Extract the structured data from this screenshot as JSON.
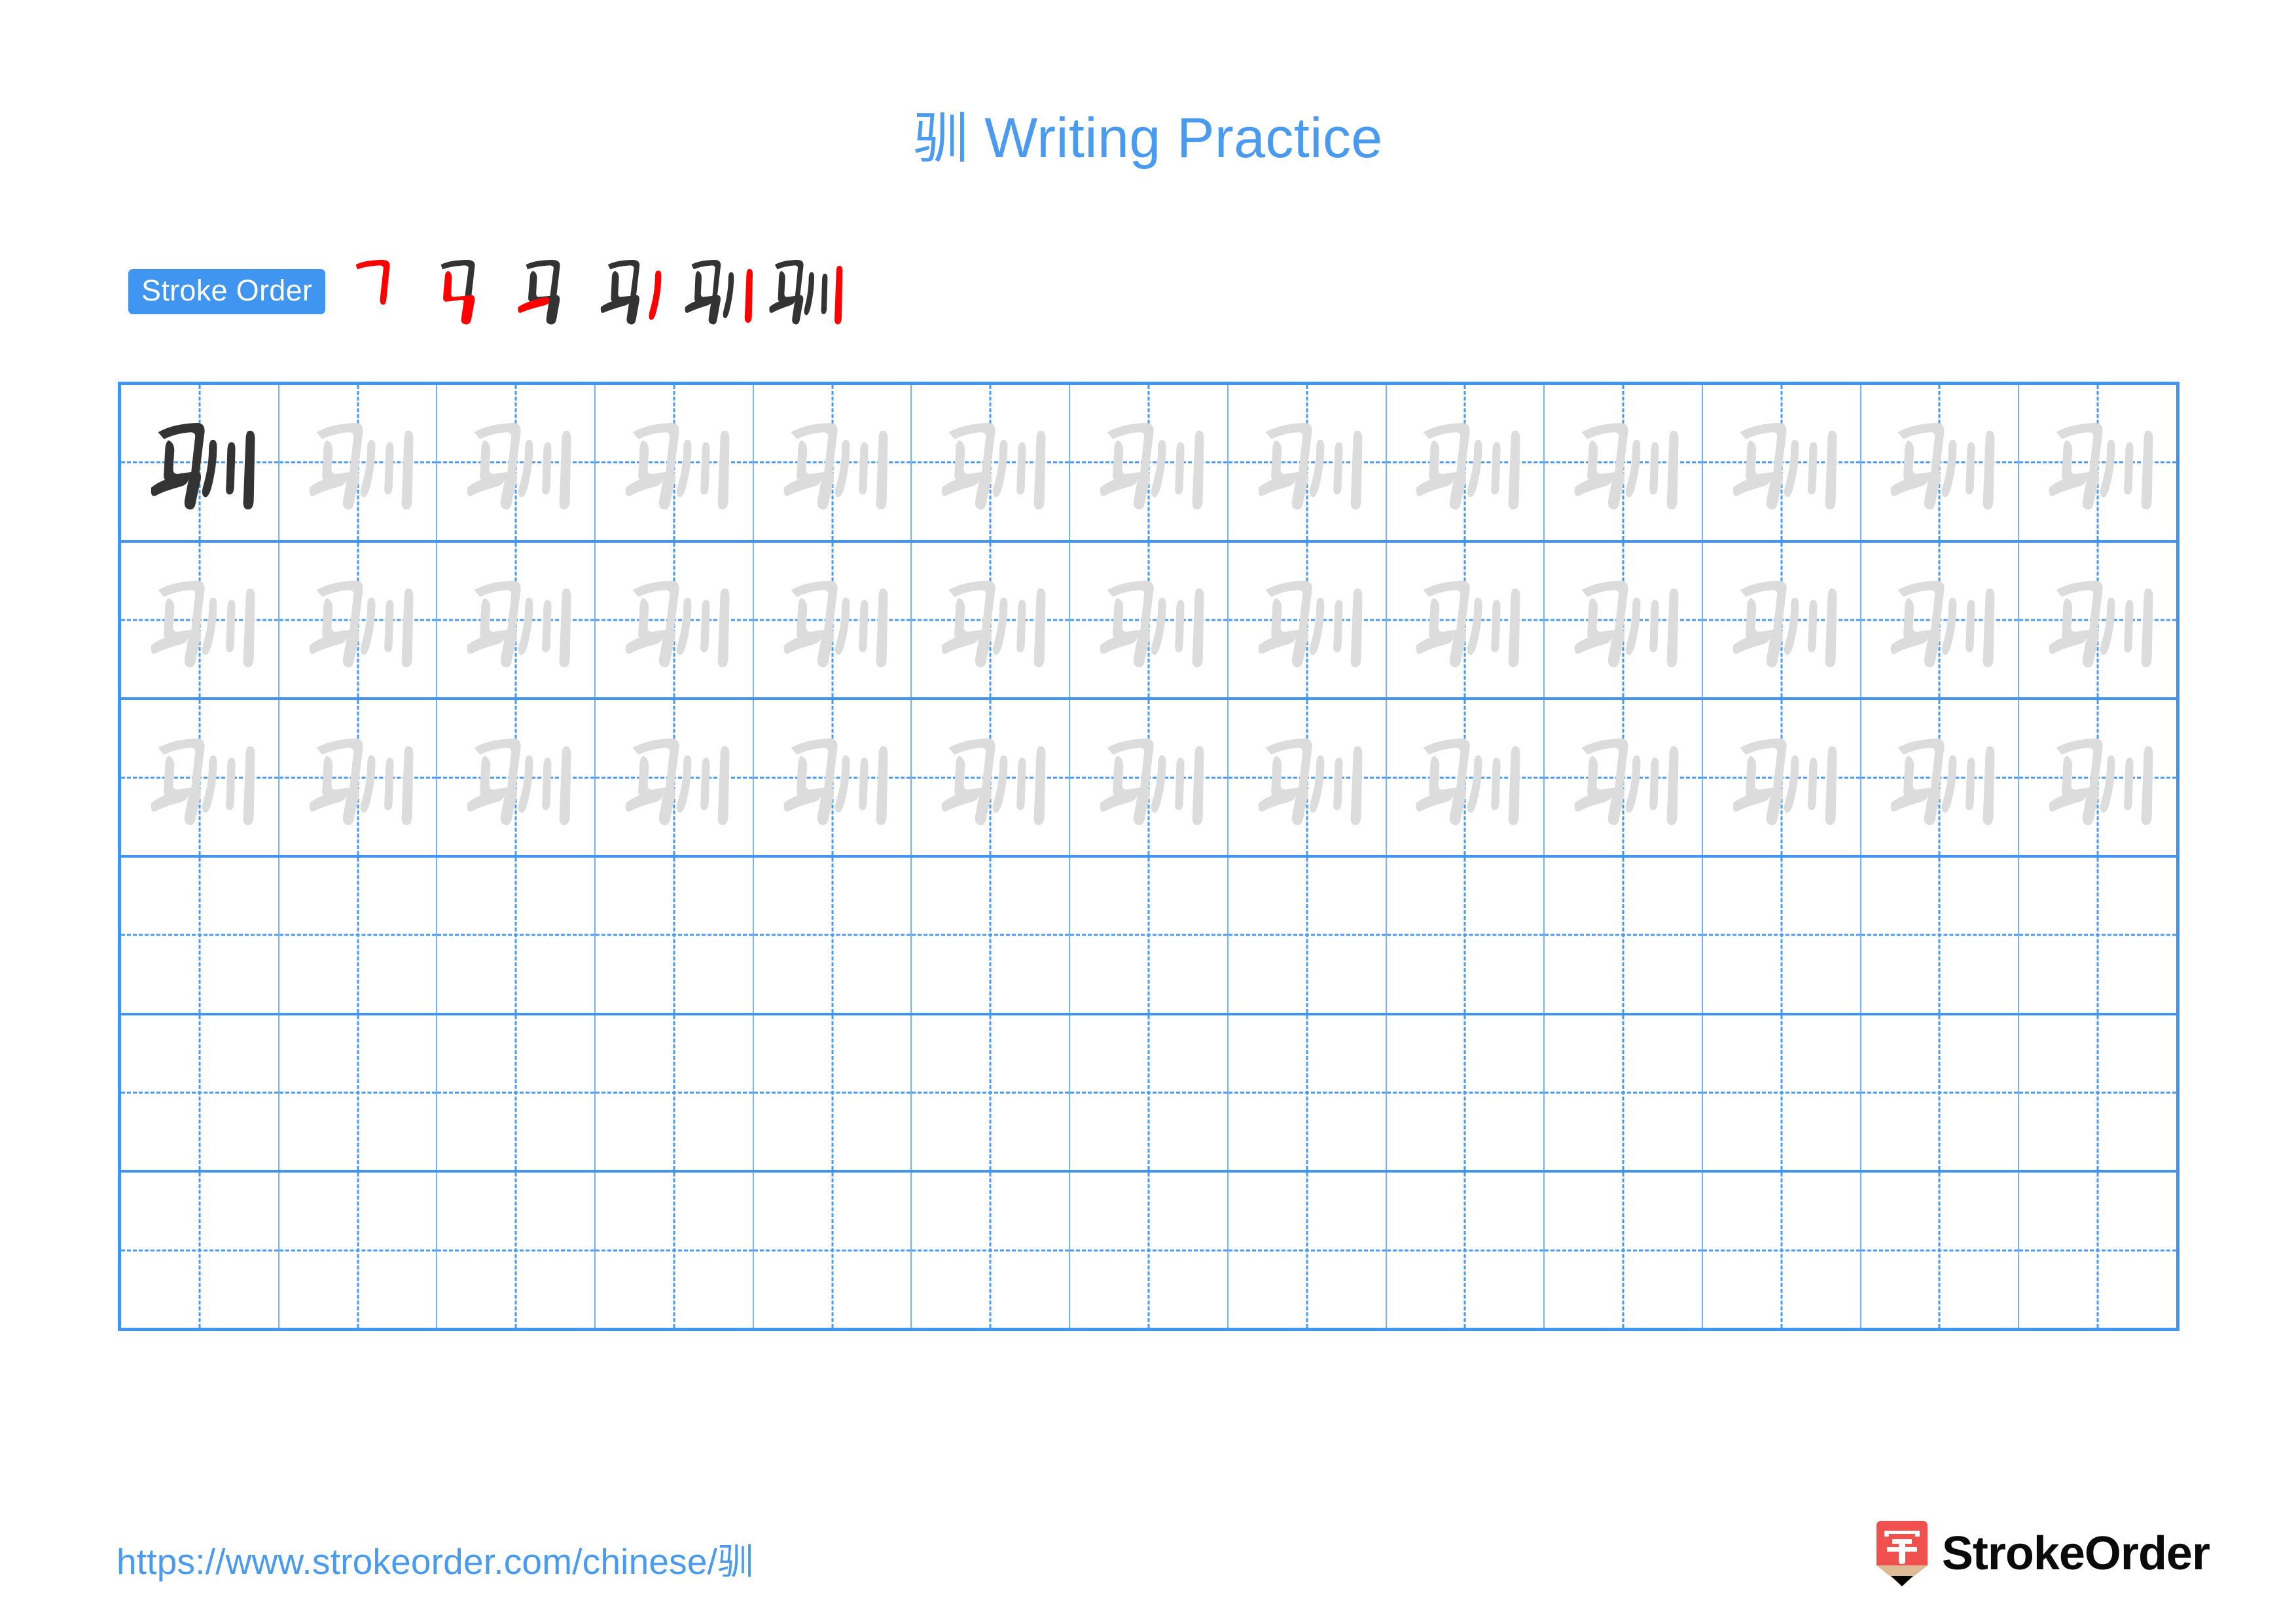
{
  "page": {
    "character": "驯",
    "title_suffix": " Writing Practice",
    "background_color": "#ffffff",
    "accent_color": "#4A9BF0"
  },
  "title": {
    "character": "驯",
    "text": "Writing Practice",
    "full": "驯 Writing Practice",
    "color": "#4A9BF0"
  },
  "stroke_order": {
    "label": "Stroke Order",
    "badge_color": "#4095F0",
    "badge_text_color": "#ffffff",
    "new_stroke_color": "#FF0000",
    "old_stroke_color": "#333333",
    "total_strokes": 6,
    "stages": [
      {
        "index": 1,
        "strokes_shown": 1,
        "new_stroke": "横折 (hengzhe)",
        "glyph": "乛"
      },
      {
        "index": 2,
        "strokes_shown": 2,
        "new_stroke": "竖折折钩 (shuzhezhegou)",
        "glyph": "马 partial"
      },
      {
        "index": 3,
        "strokes_shown": 3,
        "new_stroke": "横 (heng)",
        "glyph": "马"
      },
      {
        "index": 4,
        "strokes_shown": 4,
        "new_stroke": "撇 (pie)",
        "glyph": "马丿"
      },
      {
        "index": 5,
        "strokes_shown": 5,
        "new_stroke": "竖 (shu)",
        "glyph": "马丿丨"
      },
      {
        "index": 6,
        "strokes_shown": 6,
        "new_stroke": "竖 (shu)",
        "glyph": "驯"
      }
    ]
  },
  "practice_grid": {
    "rows": 6,
    "columns": 13,
    "total_cells": 78,
    "model_cells": 39,
    "blank_cells": 39,
    "grid_line_color": "#4095F0",
    "inner_line_color": "#74B3F3",
    "guide_line_color": "#4A9BF0",
    "model_char_color": "#333333",
    "trace_char_color": "#DCDCDC",
    "cells": [
      [
        "model",
        "trace",
        "trace",
        "trace",
        "trace",
        "trace",
        "trace",
        "trace",
        "trace",
        "trace",
        "trace",
        "trace",
        "trace"
      ],
      [
        "trace",
        "trace",
        "trace",
        "trace",
        "trace",
        "trace",
        "trace",
        "trace",
        "trace",
        "trace",
        "trace",
        "trace",
        "trace"
      ],
      [
        "trace",
        "trace",
        "trace",
        "trace",
        "trace",
        "trace",
        "trace",
        "trace",
        "trace",
        "trace",
        "trace",
        "trace",
        "trace"
      ],
      [
        "blank",
        "blank",
        "blank",
        "blank",
        "blank",
        "blank",
        "blank",
        "blank",
        "blank",
        "blank",
        "blank",
        "blank",
        "blank"
      ],
      [
        "blank",
        "blank",
        "blank",
        "blank",
        "blank",
        "blank",
        "blank",
        "blank",
        "blank",
        "blank",
        "blank",
        "blank",
        "blank"
      ],
      [
        "blank",
        "blank",
        "blank",
        "blank",
        "blank",
        "blank",
        "blank",
        "blank",
        "blank",
        "blank",
        "blank",
        "blank",
        "blank"
      ]
    ]
  },
  "footer": {
    "url": "https://www.strokeorder.com/chinese/驯",
    "url_color": "#4A9BF0",
    "logo": {
      "brand": "StrokeOrder",
      "mark_character": "字",
      "mark_color": "#F0504E",
      "mark_tip_color": "#DDBA96",
      "mark_point_color": "#000000",
      "text_color": "#0A0A0A"
    }
  }
}
